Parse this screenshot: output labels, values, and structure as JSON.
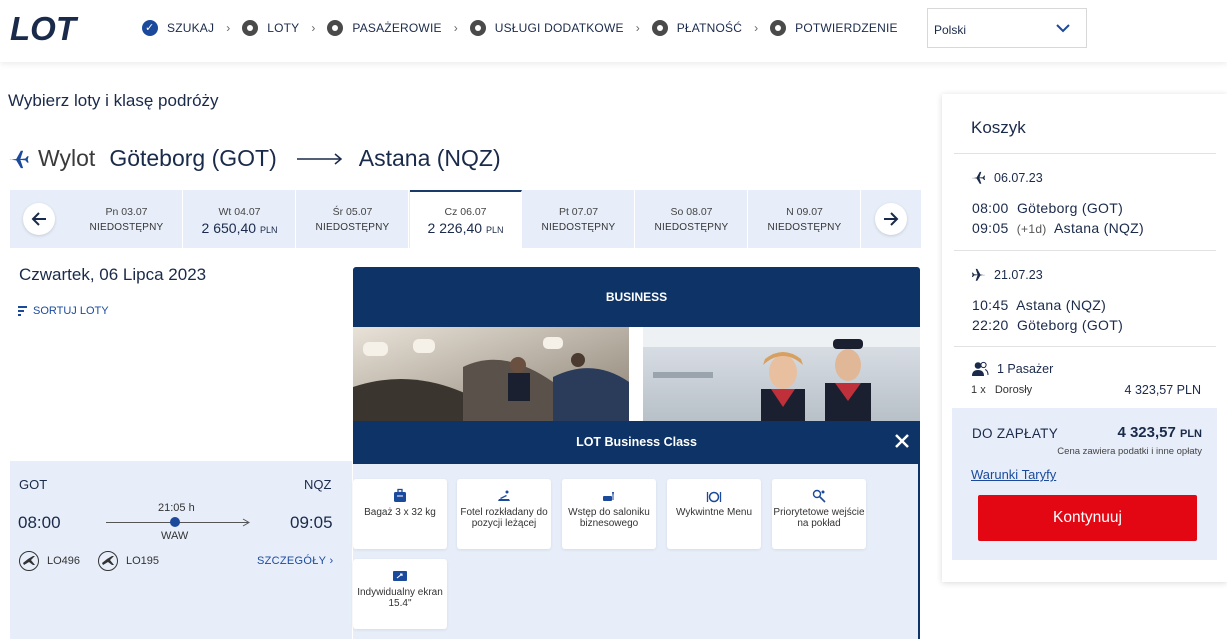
{
  "header": {
    "logo_text": "LOT",
    "steps": [
      {
        "label": "SZUKAJ",
        "state": "done"
      },
      {
        "label": "LOTY",
        "state": "pending"
      },
      {
        "label": "PASAŻEROWIE",
        "state": "pending"
      },
      {
        "label": "USŁUGI DODATKOWE",
        "state": "pending"
      },
      {
        "label": "PŁATNOŚĆ",
        "state": "pending"
      },
      {
        "label": "POTWIERDZENIE",
        "state": "pending"
      }
    ],
    "language": "Polski"
  },
  "main": {
    "title": "Wybierz loty i klasę podróży",
    "route": {
      "direction": "Wylot",
      "from": "Göteborg (GOT)",
      "to": "Astana (NQZ)"
    },
    "days": [
      {
        "date": "Pn 03.07",
        "status": "NIEDOSTĘPNY",
        "price": "",
        "currency": ""
      },
      {
        "date": "Wt 04.07",
        "status": "",
        "price": "2 650,40",
        "currency": "PLN"
      },
      {
        "date": "Śr 05.07",
        "status": "NIEDOSTĘPNY",
        "price": "",
        "currency": ""
      },
      {
        "date": "Cz 06.07",
        "status": "",
        "price": "2 226,40",
        "currency": "PLN",
        "selected": true
      },
      {
        "date": "Pt 07.07",
        "status": "NIEDOSTĘPNY",
        "price": "",
        "currency": ""
      },
      {
        "date": "So 08.07",
        "status": "NIEDOSTĘPNY",
        "price": "",
        "currency": ""
      },
      {
        "date": "N 09.07",
        "status": "NIEDOSTĘPNY",
        "price": "",
        "currency": ""
      }
    ],
    "date_heading": "Czwartek, 06 Lipca 2023",
    "sort_label": "SORTUJ LOTY"
  },
  "flight": {
    "origin": "GOT",
    "destination": "NQZ",
    "departure": "08:00",
    "arrival": "09:05",
    "duration": "21:05 h",
    "via": "WAW",
    "flight_numbers": [
      "LO496",
      "LO195"
    ],
    "details_label": "SZCZEGÓŁY"
  },
  "business": {
    "header": "BUSINESS",
    "class_title": "LOT Business Class",
    "features": [
      {
        "icon": "luggage-icon",
        "label": "Bagaż 3 x 32 kg"
      },
      {
        "icon": "reclining-seat-icon",
        "label": "Fotel rozkładany do pozycji leżącej"
      },
      {
        "icon": "lounge-icon",
        "label": "Wstęp do saloniku biznesowego"
      },
      {
        "icon": "dining-icon",
        "label": "Wykwintne Menu"
      },
      {
        "icon": "priority-boarding-icon",
        "label": "Priorytetowe wejście na pokład"
      },
      {
        "icon": "screen-icon",
        "label": "Indywidualny ekran 15.4\""
      }
    ]
  },
  "cart": {
    "title": "Koszyk",
    "outbound": {
      "date": "06.07.23",
      "dep_time": "08:00",
      "dep_city": "Göteborg (GOT)",
      "arr_time": "09:05",
      "arr_offset": "(+1d)",
      "arr_city": "Astana (NQZ)"
    },
    "inbound": {
      "date": "21.07.23",
      "dep_time": "10:45",
      "dep_city": "Astana (NQZ)",
      "arr_time": "22:20",
      "arr_city": "Göteborg (GOT)"
    },
    "passengers": "1 Pasażer",
    "pax_count": "1",
    "pax_x": "x",
    "pax_type": "Dorosły",
    "pax_amount": "4 323,57 PLN",
    "total_label": "DO ZAPŁATY",
    "total_amount": "4 323,57",
    "total_currency": "PLN",
    "total_note": "Cena zawiera podatki i inne opłaty",
    "terms_link": "Warunki Taryfy",
    "continue_label": "Kontynuuj"
  },
  "colors": {
    "brand_navy": "#0e3366",
    "accent_blue": "#1b4a9c",
    "cta_red": "#e30613",
    "light_bg": "#e7eef9"
  }
}
